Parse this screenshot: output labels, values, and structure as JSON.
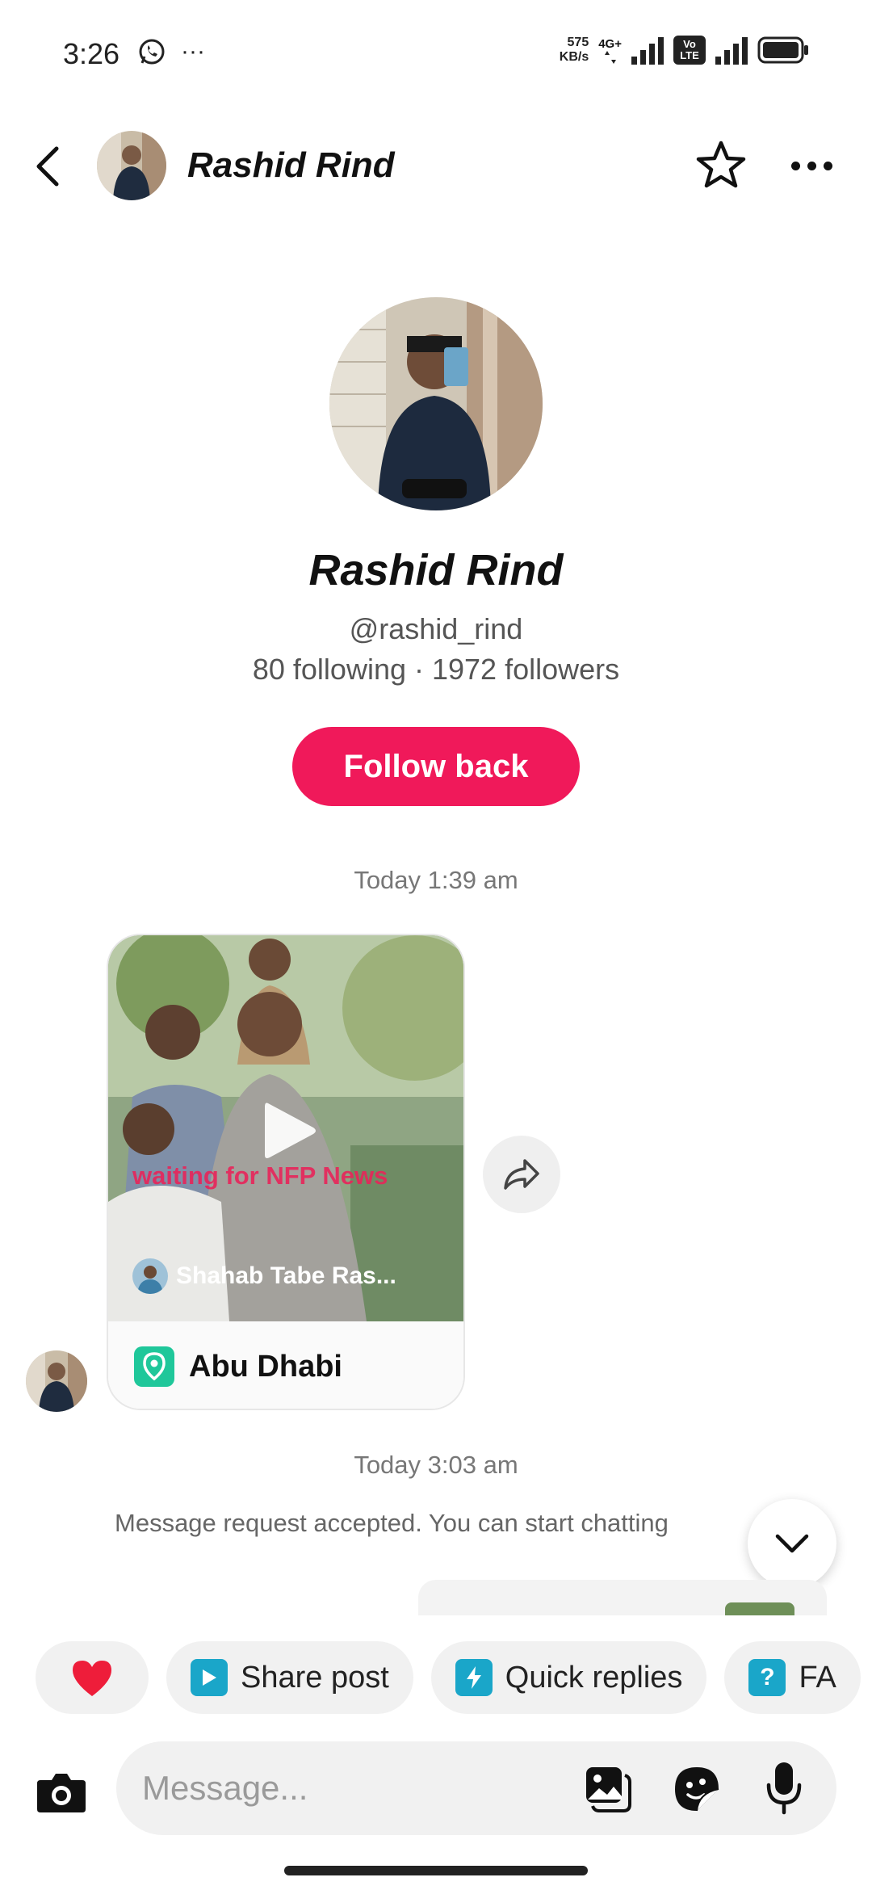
{
  "status_bar": {
    "time": "3:26",
    "whatsapp_icon": "whatsapp-icon",
    "more_indicator": "···",
    "net_speed_value": "575",
    "net_speed_unit": "KB/s",
    "network_type": "4G+",
    "volte_label": "Vo LTE"
  },
  "header": {
    "name": "Rashid Rind"
  },
  "profile": {
    "name": "Rashid Rind",
    "handle": "@rashid_rind",
    "stats": "80 following · 1972 followers",
    "follow_button": "Follow back"
  },
  "messages": {
    "timestamp_1": "Today 1:39 am",
    "shared_post": {
      "overlay_text": "waiting for NFP News",
      "author": "Shahab Tabe Ras...",
      "location": "Abu Dhabi"
    },
    "timestamp_2": "Today 3:03 am",
    "system_message": "Message request accepted. You can start chatting"
  },
  "quick_chips": {
    "share_post": "Share post",
    "quick_replies": "Quick replies",
    "faq": "FA"
  },
  "composer": {
    "placeholder": "Message..."
  },
  "colors": {
    "accent": "#f0195a",
    "location_green": "#1fc79a",
    "chip_teal": "#1aa6c9"
  }
}
